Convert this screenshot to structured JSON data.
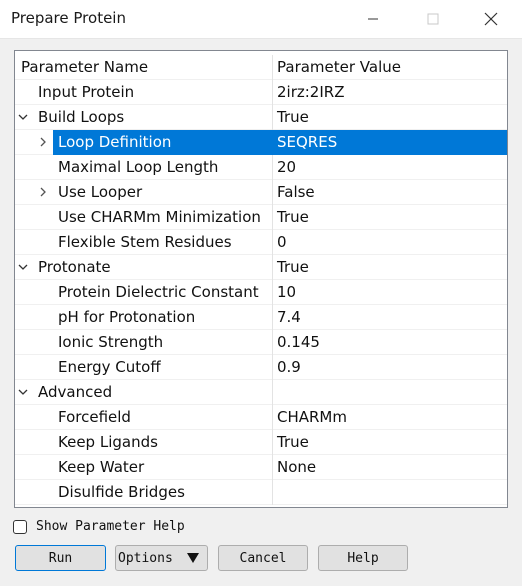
{
  "window": {
    "title": "Prepare Protein",
    "minimize_icon": "minimize-icon",
    "maximize_icon": "maximize-icon",
    "close_icon": "close-icon"
  },
  "table": {
    "header": {
      "name": "Parameter Name",
      "value": "Parameter Value"
    },
    "rows": [
      {
        "name": "Input Protein",
        "value": "2irz:2IRZ"
      },
      {
        "name": "Build Loops",
        "value": "True"
      },
      {
        "name": "Loop Definition",
        "value": "SEQRES"
      },
      {
        "name": "Maximal Loop Length",
        "value": "20"
      },
      {
        "name": "Use Looper",
        "value": "False"
      },
      {
        "name": "Use CHARMm Minimization",
        "value": "True"
      },
      {
        "name": "Flexible Stem Residues",
        "value": "0"
      },
      {
        "name": "Protonate",
        "value": "True"
      },
      {
        "name": "Protein Dielectric Constant",
        "value": "10"
      },
      {
        "name": "pH for Protonation",
        "value": "7.4"
      },
      {
        "name": "Ionic Strength",
        "value": "0.145"
      },
      {
        "name": "Energy Cutoff",
        "value": "0.9"
      },
      {
        "name": "Advanced",
        "value": ""
      },
      {
        "name": "Forcefield",
        "value": "CHARMm"
      },
      {
        "name": "Keep Ligands",
        "value": "True"
      },
      {
        "name": "Keep Water",
        "value": "None"
      },
      {
        "name": "Disulfide Bridges",
        "value": ""
      }
    ]
  },
  "footer": {
    "show_help_label": "Show Parameter Help",
    "show_help_checked": false,
    "buttons": {
      "run": "Run",
      "options": "Options",
      "cancel": "Cancel",
      "help": "Help"
    }
  },
  "colors": {
    "selection": "#0078d7",
    "accent": "#0078d7"
  }
}
